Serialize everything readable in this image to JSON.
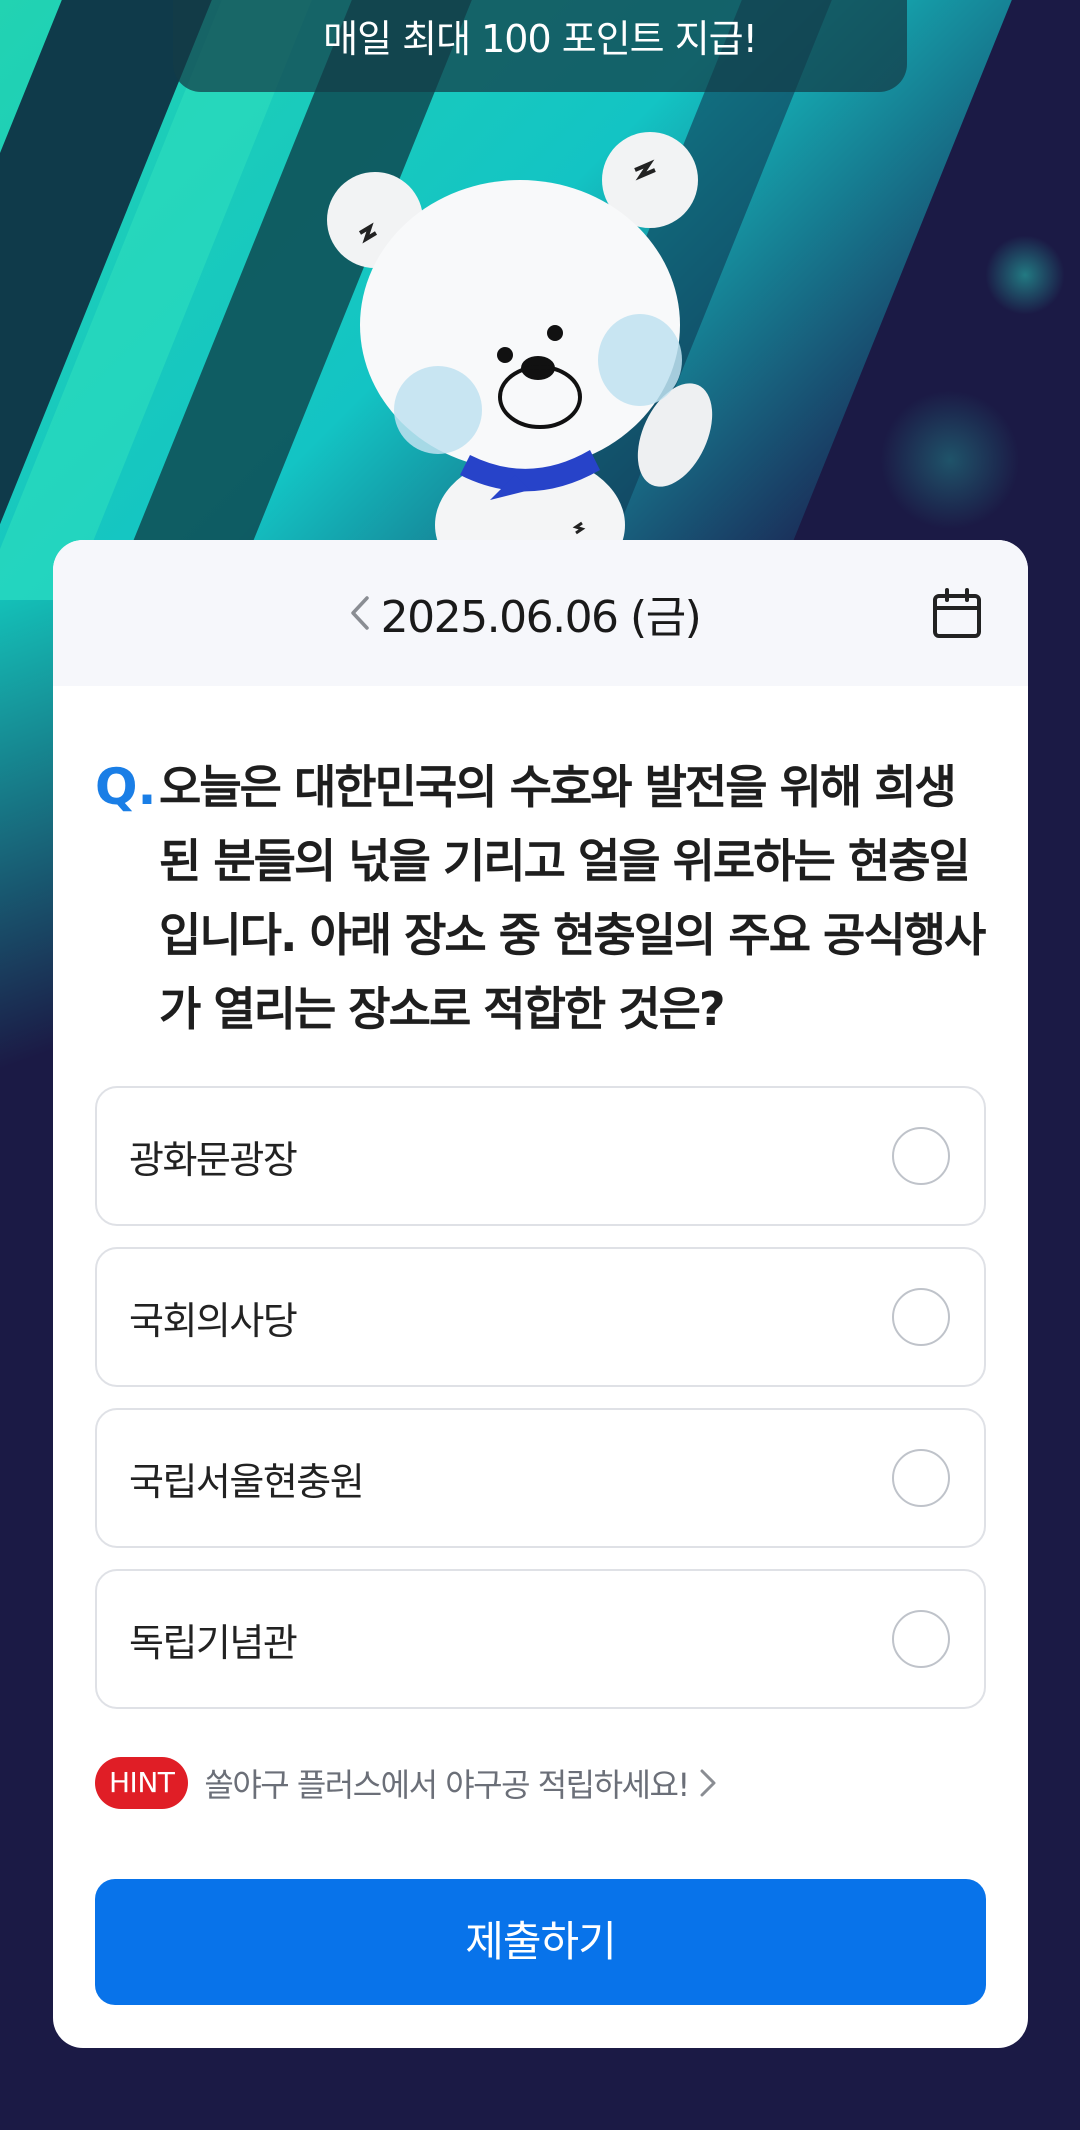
{
  "banner": {
    "text": "매일 최대 100 포인트 지급!"
  },
  "date_bar": {
    "date": "2025.06.06 (금)"
  },
  "question": {
    "mark": "Q.",
    "text": "오늘은 대한민국의 수호와 발전을 위해 희생된 분들의 넋을 기리고 얼을 위로하는 현충일입니다. 아래 장소 중 현충일의 주요 공식행사가 열리는 장소로 적합한 것은?"
  },
  "options": [
    {
      "label": "광화문광장"
    },
    {
      "label": "국회의사당"
    },
    {
      "label": "국립서울현충원"
    },
    {
      "label": "독립기념관"
    }
  ],
  "hint": {
    "badge": "HINT",
    "text": "쏠야구 플러스에서 야구공 적립하세요!"
  },
  "submit": {
    "label": "제출하기"
  },
  "colors": {
    "accent": "#0873ea",
    "hint_badge": "#e01e26",
    "question_mark": "#1a7ee6",
    "page_bg": "#1b1a45"
  },
  "icons": {
    "prev": "chevron-left-icon",
    "calendar": "calendar-icon",
    "hint_arrow": "chevron-right-icon",
    "mascot": "polar-bear-mascot"
  }
}
